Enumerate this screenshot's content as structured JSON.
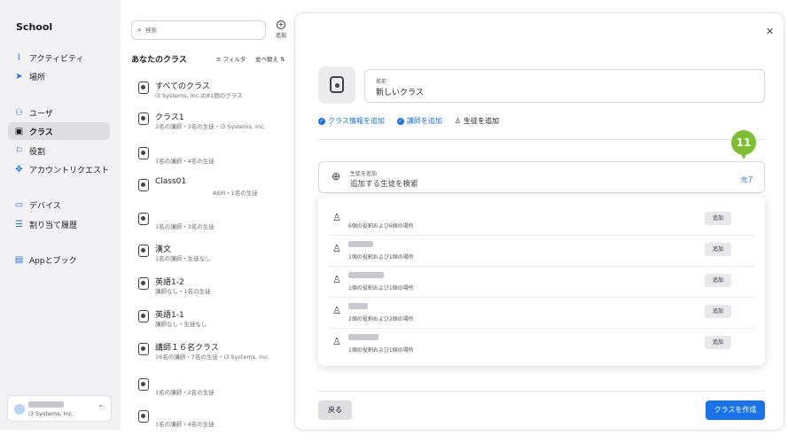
{
  "sidebar": {
    "brand": "School",
    "items": [
      {
        "label": "アクティビティ",
        "icon": "activity-icon"
      },
      {
        "label": "場所",
        "icon": "location-icon"
      },
      {
        "label": "ユーザ",
        "icon": "users-icon"
      },
      {
        "label": "クラス",
        "icon": "class-icon"
      },
      {
        "label": "役割",
        "icon": "flag-icon"
      },
      {
        "label": "アカウントリクエスト",
        "icon": "request-icon"
      },
      {
        "label": "デバイス",
        "icon": "laptop-icon"
      },
      {
        "label": "割り当て履歴",
        "icon": "history-icon"
      },
      {
        "label": "Appとブック",
        "icon": "apps-icon"
      }
    ],
    "account": {
      "org": "i3 Systems, Inc."
    }
  },
  "listpane": {
    "search_placeholder": "検索",
    "add_label": "追加",
    "title": "あなたのクラス",
    "filter_label": "フィルタ",
    "sort_label": "並べ替え",
    "classes": [
      {
        "name": "すべてのクラス",
        "sub": "i3 Systems, Inc.の81個のクラス"
      },
      {
        "name": "クラス1",
        "sub": "2名の講師・3名の生徒・i3 Systems, Inc."
      },
      {
        "name": "",
        "sub": "1名の講師・4名の生徒"
      },
      {
        "name": "Class01",
        "sub": "ASM・1名の生徒"
      },
      {
        "name": "",
        "sub": "1名の講師・3名の生徒"
      },
      {
        "name": "漢文",
        "sub": "1名の講師・生徒なし"
      },
      {
        "name": "英語1-2",
        "sub": "講師なし・1名の生徒"
      },
      {
        "name": "英語1-1",
        "sub": "講師なし・生徒なし"
      },
      {
        "name": "講師１６名クラス",
        "sub": "16名の講師・7名の生徒・i3 Systems, Inc."
      },
      {
        "name": "",
        "sub": "1名の講師・2名の生徒"
      },
      {
        "name": "",
        "sub": "1名の講師・4名の生徒"
      }
    ]
  },
  "modal": {
    "name_label": "名前",
    "name_value": "新しいクラス",
    "steps": [
      {
        "label": "クラス情報を追加"
      },
      {
        "label": "講師を追加"
      },
      {
        "label": "生徒を追加"
      }
    ],
    "callout_number": "11",
    "student_search_label": "生徒を追加",
    "student_search_placeholder": "追加する生徒を検索",
    "done_label": "完了",
    "results": [
      {
        "desc": "6個の役割および6個の場所",
        "add": "追加"
      },
      {
        "desc": "1個の役割および1個の場所",
        "add": "追加"
      },
      {
        "desc": "1個の役割および1個の場所",
        "add": "追加"
      },
      {
        "desc": "2個の役割および2個の場所",
        "add": "追加"
      },
      {
        "desc": "1個の役割および1個の場所",
        "add": "追加"
      }
    ],
    "back_label": "戻る",
    "create_label": "クラスを作成"
  },
  "colors": {
    "accent": "#1a73e8",
    "callout": "#7cbf2f"
  }
}
